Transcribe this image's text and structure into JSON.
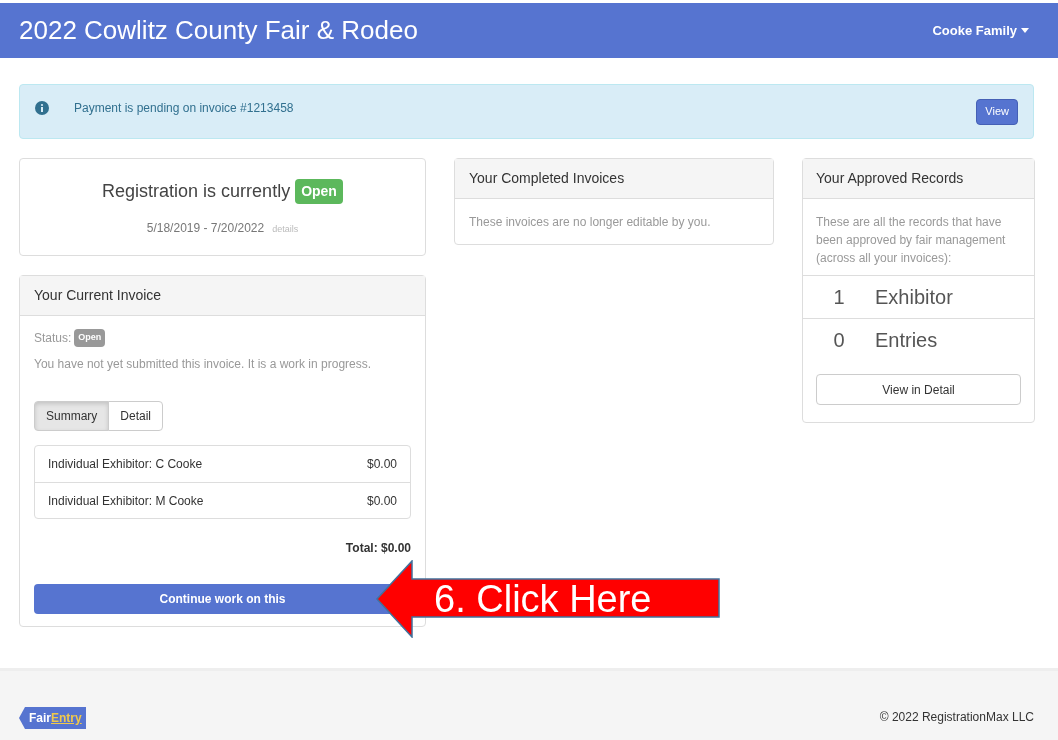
{
  "header": {
    "title": "2022 Cowlitz County Fair & Rodeo",
    "user_menu": "Cooke Family"
  },
  "alert": {
    "text": "Payment is pending on invoice #1213458",
    "button": "View"
  },
  "registration": {
    "text": "Registration is currently",
    "status": "Open",
    "dates": "5/18/2019 - 7/20/2022",
    "details_link": "details"
  },
  "current_invoice": {
    "title": "Your Current Invoice",
    "status_label": "Status:",
    "status": "Open",
    "note": "You have not yet submitted this invoice. It is a work in progress.",
    "tabs": [
      {
        "label": "Summary",
        "selected": true
      },
      {
        "label": "Detail",
        "selected": false
      }
    ],
    "items": [
      {
        "name": "Individual Exhibitor: C Cooke",
        "amount": "$0.00"
      },
      {
        "name": "Individual Exhibitor: M Cooke",
        "amount": "$0.00"
      }
    ],
    "total": "Total: $0.00",
    "button": "Continue work on this"
  },
  "completed_invoices": {
    "title": "Your Completed Invoices",
    "text": "These invoices are no longer editable by you."
  },
  "approved_records": {
    "title": "Your Approved Records",
    "text": "These are all the records that have been approved by fair management (across all your invoices):",
    "records": [
      {
        "count": "1",
        "label": "Exhibitor"
      },
      {
        "count": "0",
        "label": "Entries"
      }
    ],
    "button": "View in Detail"
  },
  "annotation": {
    "text": "6. Click Here"
  },
  "footer": {
    "logo_part1": "Fair",
    "logo_part2": "Entry",
    "copyright": "© 2022 RegistrationMax LLC"
  }
}
